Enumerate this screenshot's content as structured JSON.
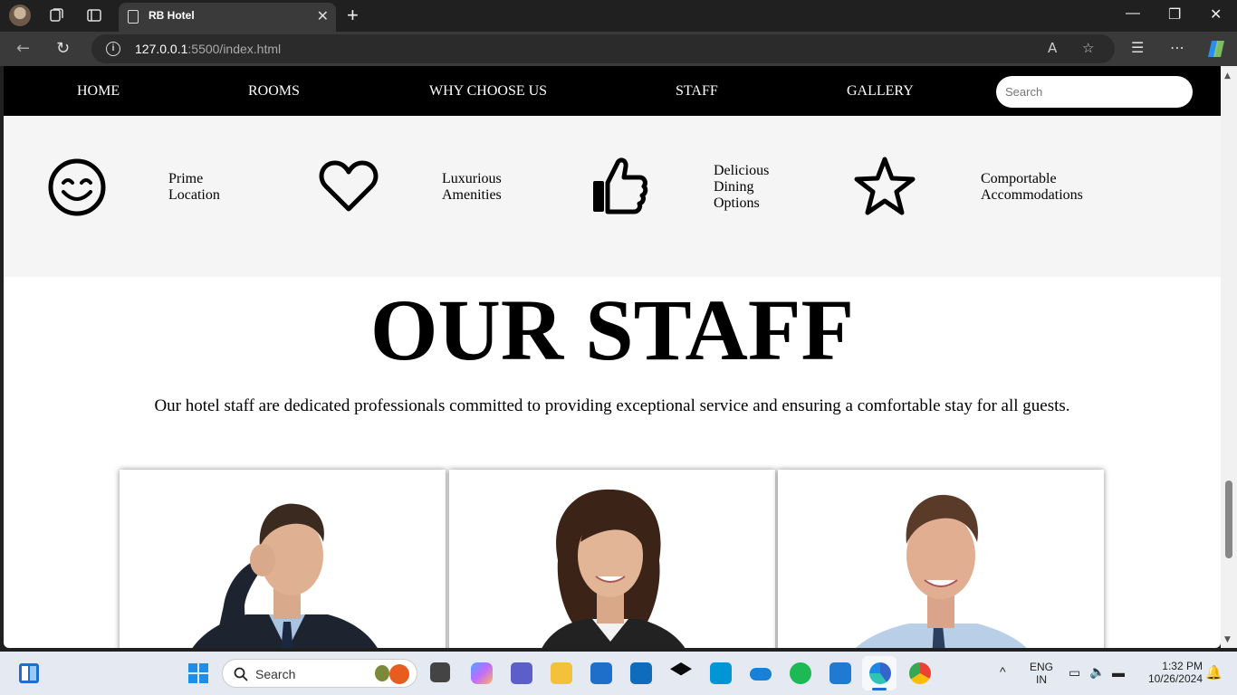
{
  "browser": {
    "tab_title": "RB Hotel",
    "url_host": "127.0.0.1",
    "url_rest": ":5500/index.html"
  },
  "nav": {
    "links": [
      "HOME",
      "ROOMS",
      "WHY CHOOSE US",
      "STAFF",
      "GALLERY"
    ],
    "search_placeholder": "Search"
  },
  "features": [
    {
      "icon": "smile-icon",
      "lines": [
        "Prime",
        "Location"
      ]
    },
    {
      "icon": "heart-icon",
      "lines": [
        "Luxurious",
        "Amenities"
      ]
    },
    {
      "icon": "thumbs-up-icon",
      "lines": [
        "Delicious",
        "Dining",
        "Options"
      ]
    },
    {
      "icon": "star-icon",
      "lines": [
        "Comportable",
        "Accommodations"
      ]
    }
  ],
  "staff": {
    "title": "OUR STAFF",
    "description": "Our hotel staff are dedicated professionals committed to providing exceptional service and ensuring a comfortable stay for all guests."
  },
  "taskbar": {
    "search_label": "Search",
    "lang_line1": "ENG",
    "lang_line2": "IN",
    "time": "1:32 PM",
    "date": "10/26/2024"
  }
}
